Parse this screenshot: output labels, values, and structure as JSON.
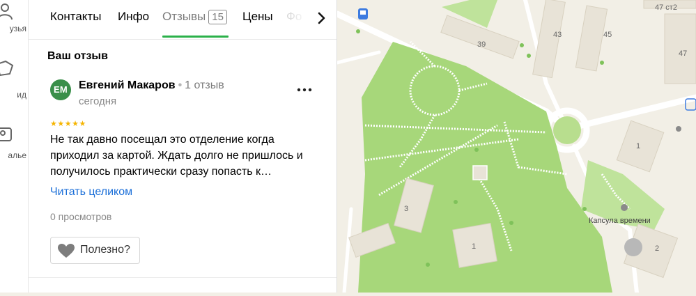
{
  "rail": {
    "items": [
      {
        "label": "узья",
        "icon": "people-icon"
      },
      {
        "label": "ид",
        "icon": "guide-icon"
      },
      {
        "label": "алье",
        "icon": "gallery-icon"
      }
    ]
  },
  "tabs": [
    {
      "label": "Контакты"
    },
    {
      "label": "Инфо"
    },
    {
      "label": "Отзывы",
      "count": "15",
      "active": true
    },
    {
      "label": "Цены"
    },
    {
      "label": "Фо"
    }
  ],
  "review": {
    "section_title": "Ваш отзыв",
    "avatar_initials": "ЕМ",
    "author": "Евгений Макаров",
    "author_reviews": "1 отзыв",
    "date": "сегодня",
    "stars": 5,
    "stars_text": "★★★★★",
    "text": "Не так давно посещал это отделение когда приходил за картой. Ждать долго не пришлось и получилось практически сразу попасть к…",
    "read_more": "Читать целиком",
    "views": "0 просмотров",
    "useful_label": "Полезно?"
  },
  "map": {
    "labels": {
      "b47": "47 ст2",
      "b43": "43",
      "b45": "45",
      "b39": "39",
      "b47b": "47",
      "b1a": "1",
      "b3": "3",
      "b1b": "1",
      "b2": "2",
      "poi": "Капсула времени"
    }
  },
  "colors": {
    "accent": "#2bb14a",
    "link": "#1a6ed8",
    "park": "#a7d77a",
    "avatar": "#3a8f4a",
    "stars": "#f5b400"
  }
}
